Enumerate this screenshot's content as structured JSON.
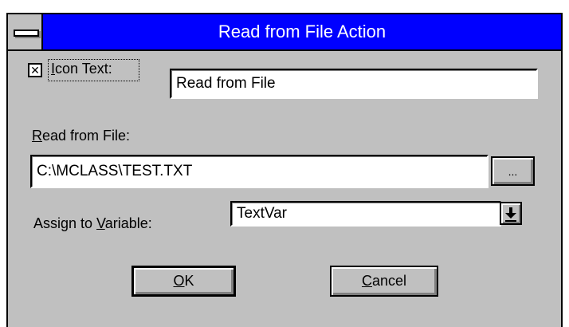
{
  "window": {
    "title": "Read from File Action"
  },
  "icon_text": {
    "checked": "✕",
    "label_prefix": "",
    "label_mnemonic": "I",
    "label_rest": "con Text:",
    "value": "Read from File"
  },
  "read_file": {
    "label_mnemonic": "R",
    "label_rest": "ead from File:",
    "value": "C:\\MCLASS\\TEST.TXT",
    "browse_label": "..."
  },
  "variable": {
    "label_prefix": "Assign to ",
    "label_mnemonic": "V",
    "label_rest": "ariable:",
    "value": "TextVar"
  },
  "buttons": {
    "ok": {
      "mnemonic": "O",
      "rest": "K"
    },
    "cancel": {
      "mnemonic": "C",
      "rest": "ancel"
    }
  }
}
